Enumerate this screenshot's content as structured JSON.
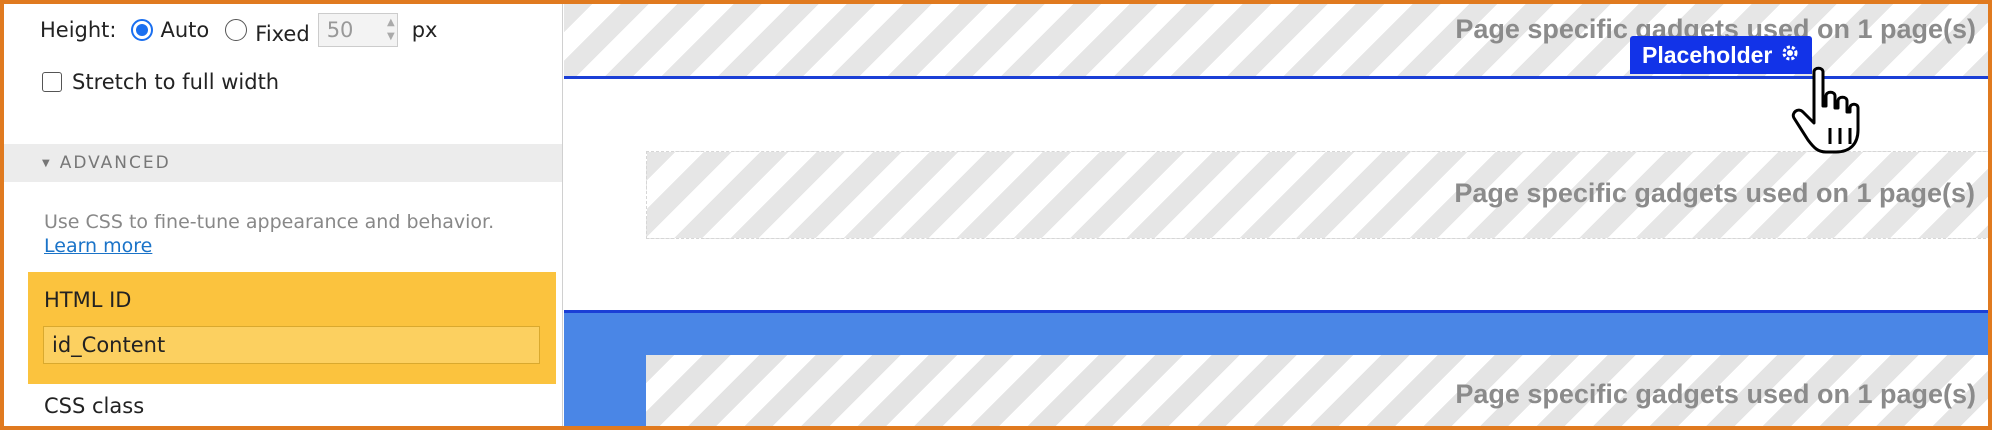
{
  "height_row": {
    "label": "Height:",
    "auto_label": "Auto",
    "fixed_label": "Fixed",
    "fixed_value": "50",
    "unit": "px",
    "selected": "Auto"
  },
  "stretch": {
    "label": "Stretch to full width",
    "checked": false
  },
  "advanced": {
    "title": "ADVANCED",
    "help_text": "Use CSS to fine-tune appearance and behavior.",
    "learn_more": "Learn more"
  },
  "html_id": {
    "label": "HTML ID",
    "value": "id_Content"
  },
  "css_class": {
    "label": "CSS class"
  },
  "canvas": {
    "gadget_top": "Page specific gadgets used on 1 page(s)",
    "gadget_mid": "Page specific gadgets used on 1 page(s)",
    "gadget_bottom": "Page specific gadgets used on 1 page(s)",
    "placeholder_label": "Placeholder",
    "accent_blue": "#1233e8",
    "band_blue": "#4a86e6"
  },
  "icons": [
    "caret-down-icon",
    "gear-icon",
    "hand-pointer-icon"
  ]
}
